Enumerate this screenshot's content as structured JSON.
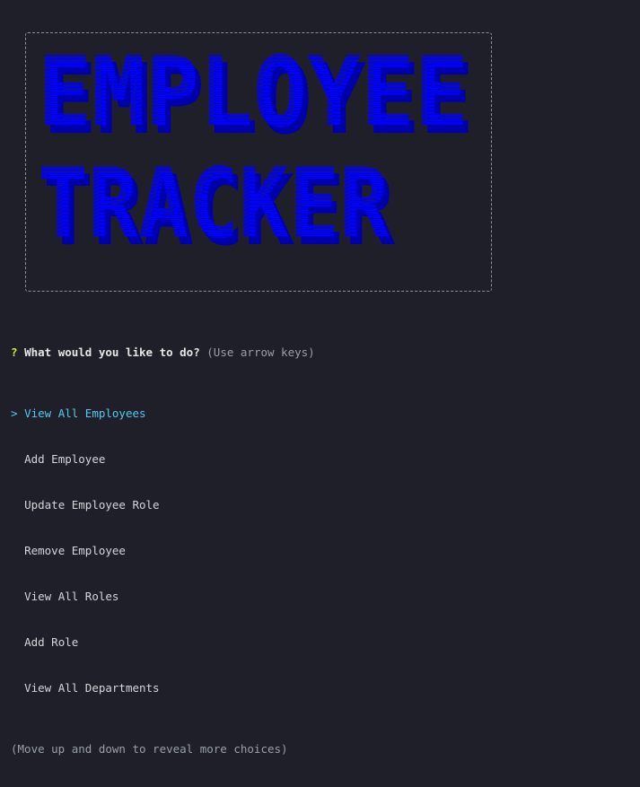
{
  "banner": {
    "line1": "EMPLOYEE",
    "line2": "TRACKER",
    "colors": {
      "face": "#0000ff",
      "shadow": "#0000aa",
      "border": "#8a8f98"
    }
  },
  "prompt": {
    "qmark": "?",
    "question": "What would you like to do?",
    "hint": "(Use arrow keys)",
    "pointer": ">",
    "choices": [
      {
        "label": "View All Employees",
        "selected": true
      },
      {
        "label": "Add Employee",
        "selected": false
      },
      {
        "label": "Update Employee Role",
        "selected": false
      },
      {
        "label": "Remove Employee",
        "selected": false
      },
      {
        "label": "View All Roles",
        "selected": false
      },
      {
        "label": "Add Role",
        "selected": false
      },
      {
        "label": "View All Departments",
        "selected": false
      }
    ],
    "footer": "(Move up and down to reveal more choices)"
  },
  "theme": {
    "background": "#1e1f29",
    "selected": "#56c8f0",
    "qmark": "#d6e34f"
  }
}
